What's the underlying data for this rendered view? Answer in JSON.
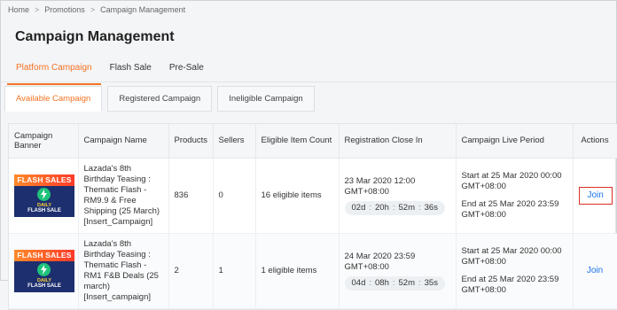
{
  "breadcrumb": [
    "Home",
    "Promotions",
    "Campaign Management"
  ],
  "page_title": "Campaign Management",
  "top_tabs": [
    {
      "label": "Platform Campaign",
      "active": true
    },
    {
      "label": "Flash Sale",
      "active": false
    },
    {
      "label": "Pre-Sale",
      "active": false
    }
  ],
  "sub_tabs": [
    {
      "label": "Available Campaign",
      "active": true
    },
    {
      "label": "Registered Campaign",
      "active": false
    },
    {
      "label": "Ineligible Campaign",
      "active": false
    }
  ],
  "table": {
    "headers": [
      "Campaign Banner",
      "Campaign Name",
      "Products",
      "Sellers",
      "Eligible Item Count",
      "Registration Close In",
      "Campaign Live Period",
      "Actions"
    ],
    "banner": {
      "line1": "FLASH SALES",
      "line2": "DAILY",
      "line3": "FLASH SALE"
    },
    "rows": [
      {
        "name": "Lazada's 8th Birthday Teasing : Thematic Flash - RM9.9 & Free Shipping (25 March) [Insert_Campaign]",
        "products": "836",
        "sellers": "0",
        "eligible": "16 eligible items",
        "close_date": "23 Mar 2020 12:00 GMT+08:00",
        "countdown": {
          "d": "02d",
          "h": "20h",
          "m": "52m",
          "s": "36s"
        },
        "start": "Start at 25 Mar 2020 00:00 GMT+08:00",
        "end": "End at 25 Mar 2020 23:59 GMT+08:00",
        "action": "Join"
      },
      {
        "name": "Lazada's 8th Birthday Teasing : Thematic Flash - RM1 F&B Deals (25 march) [Insert_campaign]",
        "products": "2",
        "sellers": "1",
        "eligible": "1 eligible items",
        "close_date": "24 Mar 2020 23:59 GMT+08:00",
        "countdown": {
          "d": "04d",
          "h": "08h",
          "m": "52m",
          "s": "35s"
        },
        "start": "Start at 25 Mar 2020 00:00 GMT+08:00",
        "end": "End at 25 Mar 2020 23:59 GMT+08:00",
        "action": "Join"
      }
    ]
  },
  "colors": {
    "accent": "#f57224",
    "link": "#1a73e8",
    "highlight_box": "#d93025"
  }
}
